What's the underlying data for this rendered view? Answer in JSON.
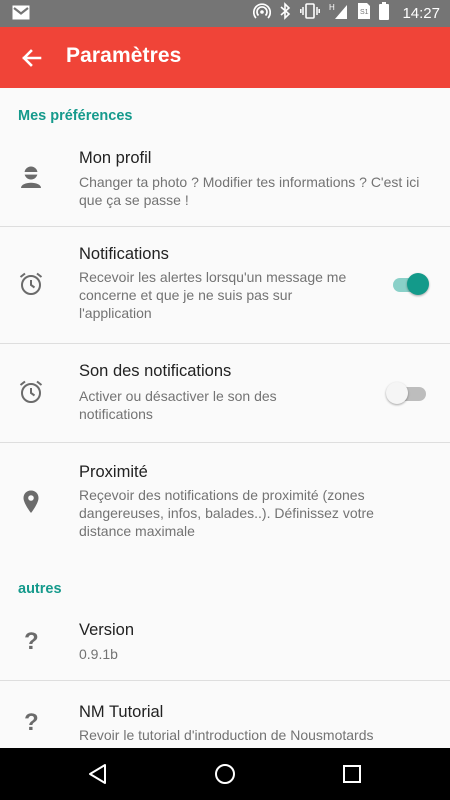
{
  "status_bar": {
    "time": "14:27",
    "icons": [
      "gmail-icon",
      "hotspot-icon",
      "bluetooth-icon",
      "vibrate-icon",
      "signal-icon",
      "sim-icon",
      "battery-icon"
    ]
  },
  "toolbar": {
    "title": "Paramètres",
    "color": "#f04438"
  },
  "sections": {
    "preferences": {
      "header": "Mes préférences",
      "items": [
        {
          "title": "Mon profil",
          "summary": "Changer ta photo ? Modifier tes informations ? C'est ici que ça se passe !",
          "icon": "profile-icon"
        },
        {
          "title": "Notifications",
          "summary": "Recevoir les alertes lorsqu'un message me concerne et que je ne suis pas sur l'application",
          "icon": "alarm-icon",
          "toggle": true
        },
        {
          "title": "Son des notifications",
          "summary": "Activer ou désactiver le son des notifications",
          "icon": "alarm-icon",
          "toggle": false
        },
        {
          "title": "Proximité",
          "summary": "Reçevoir des notifications de proximité (zones dangereuses, infos, balades..). Définissez votre distance maximale",
          "icon": "location-pin-icon"
        }
      ]
    },
    "others": {
      "header": "autres",
      "items": [
        {
          "title": "Version",
          "summary": "0.9.1b",
          "icon": "help-icon"
        },
        {
          "title": "NM Tutorial",
          "summary": "Revoir le tutorial d'introduction de Nousmotards",
          "icon": "help-icon"
        }
      ]
    }
  },
  "accent_color": "#159a8c"
}
